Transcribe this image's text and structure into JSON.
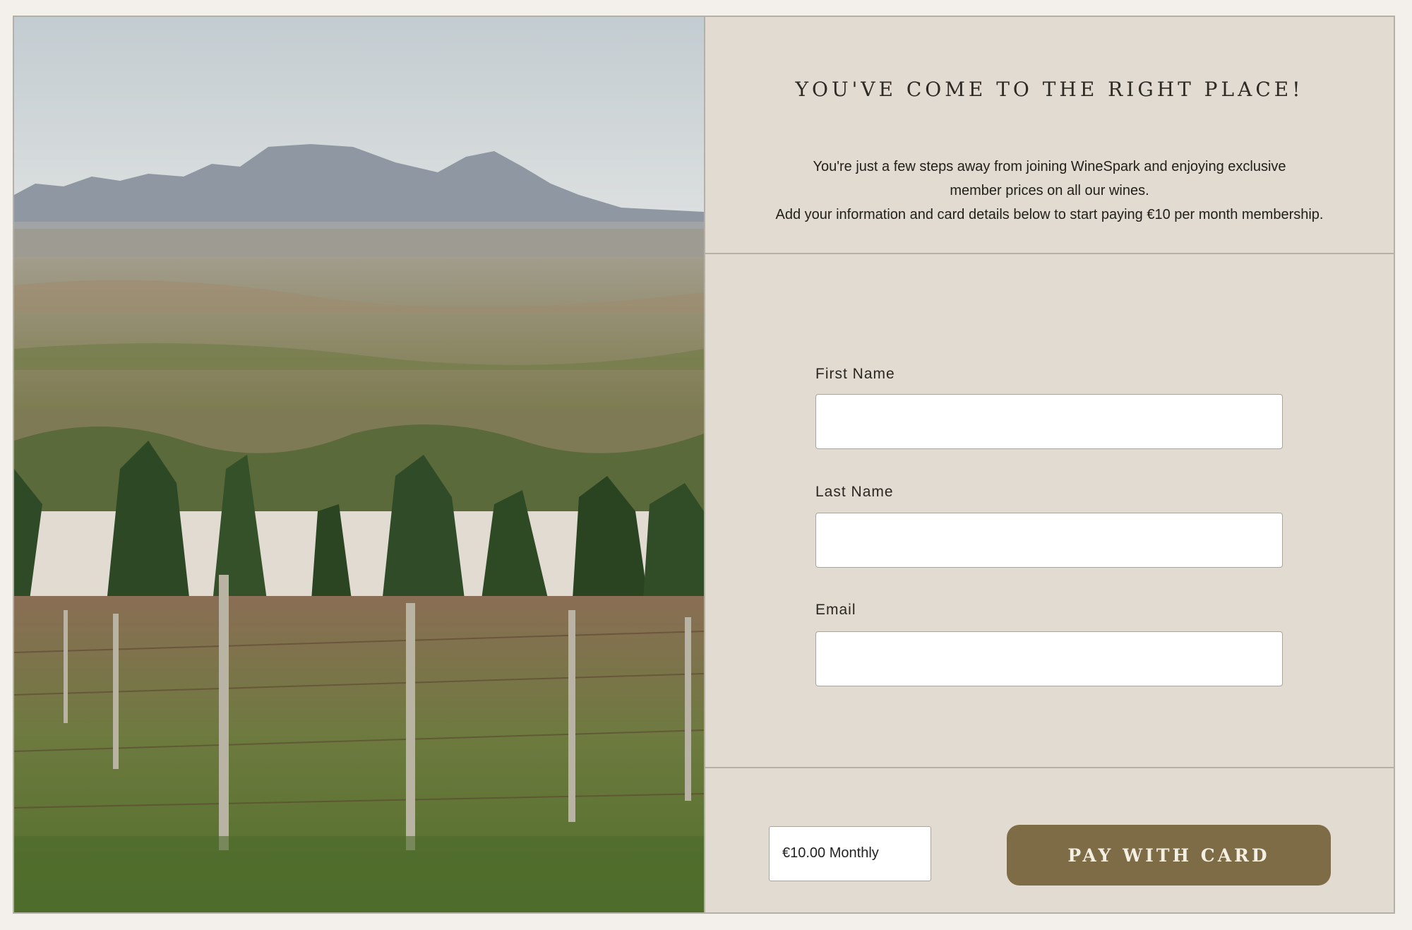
{
  "hero": {
    "image": "vineyard-landscape-photo"
  },
  "header": {
    "title": "YOU'VE COME TO THE RIGHT PLACE!",
    "intro_line1": "You're just a few steps away from joining WineSpark and enjoying exclusive",
    "intro_line2": "member prices on all our wines.",
    "intro_line3": "Add your information and card details below to start paying €10 per month membership."
  },
  "form": {
    "first_name": {
      "label": "First Name",
      "value": "",
      "placeholder": ""
    },
    "last_name": {
      "label": "Last Name",
      "value": "",
      "placeholder": ""
    },
    "email": {
      "label": "Email",
      "value": "",
      "placeholder": ""
    }
  },
  "footer": {
    "price": "€10.00 Monthly",
    "pay_button": "PAY WITH CARD"
  },
  "colors": {
    "page_bg": "#f3f0eb",
    "panel_bg": "#e1dbd1",
    "border": "#b4b0a6",
    "button_bg": "#7d6c46",
    "button_text": "#f4efe3"
  }
}
